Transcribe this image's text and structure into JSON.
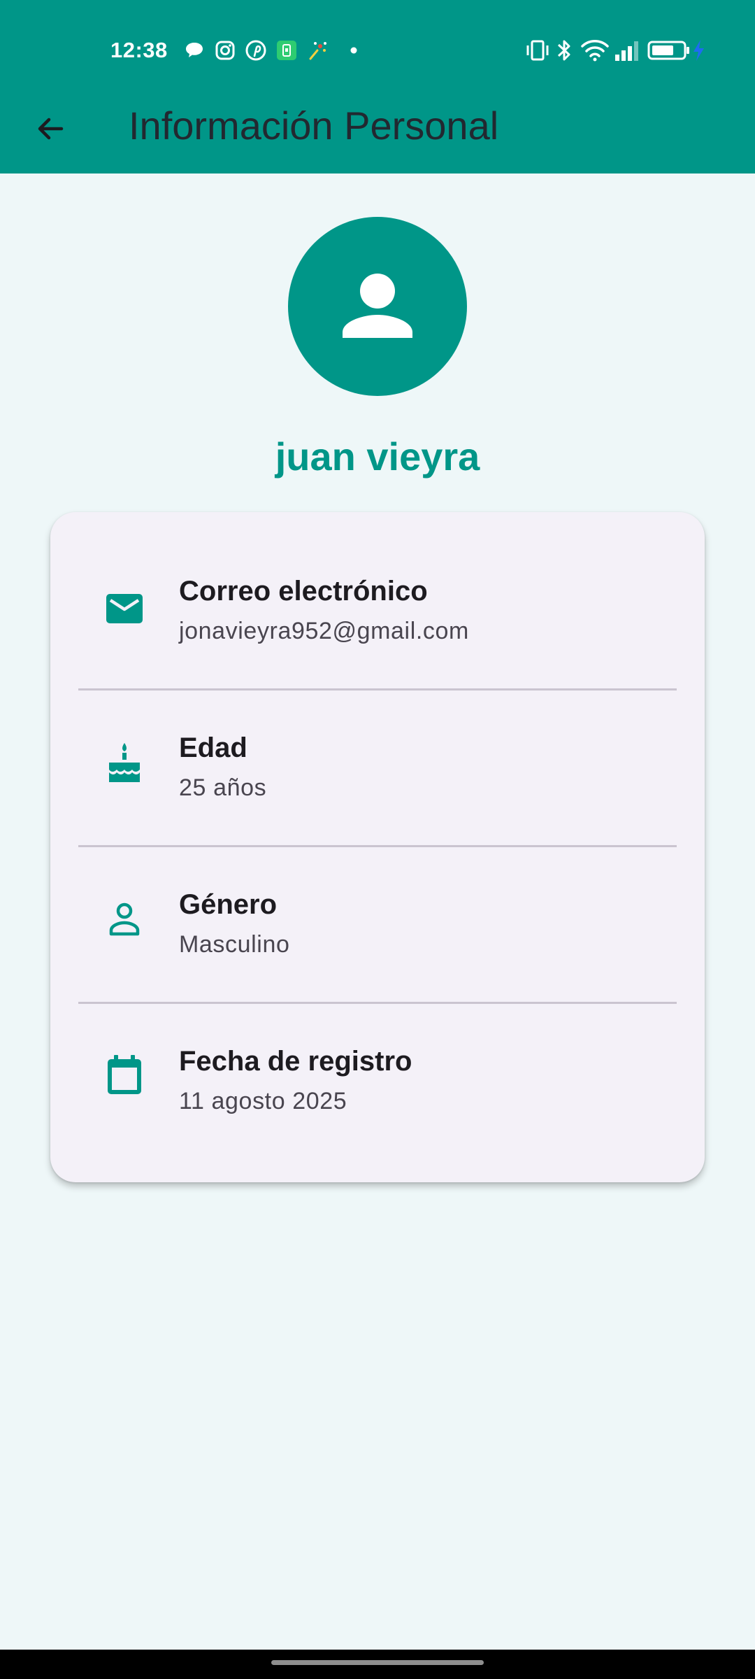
{
  "status_bar": {
    "time": "12:38",
    "notification_icons": [
      "chat-bubble-icon",
      "instagram-icon",
      "pinterest-icon",
      "sim-card-app-icon",
      "fireworks-icon",
      "dot-icon"
    ],
    "system_icons": [
      "vibrate-icon",
      "bluetooth-icon",
      "wifi-icon",
      "signal-icon",
      "battery-icon",
      "charging-icon"
    ]
  },
  "app_bar": {
    "title": "Información Personal",
    "back_icon": "arrow-back-icon"
  },
  "profile": {
    "avatar_icon": "person-icon",
    "name": "juan vieyra"
  },
  "info": {
    "email": {
      "icon": "mail-icon",
      "label": "Correo electrónico",
      "value": "jonavieyra952@gmail.com"
    },
    "age": {
      "icon": "cake-icon",
      "label": "Edad",
      "value": "25 años"
    },
    "gender": {
      "icon": "person-outline-icon",
      "label": "Género",
      "value": "Masculino"
    },
    "registered": {
      "icon": "calendar-icon",
      "label": "Fecha de registro",
      "value": "11 agosto 2025"
    }
  },
  "colors": {
    "primary": "#009688",
    "background": "#EEF7F8",
    "card": "#F4F1F8",
    "title_text": "#222830",
    "label_text": "#1D1B20",
    "value_text": "#49454F",
    "divider": "#CAC4D0"
  }
}
